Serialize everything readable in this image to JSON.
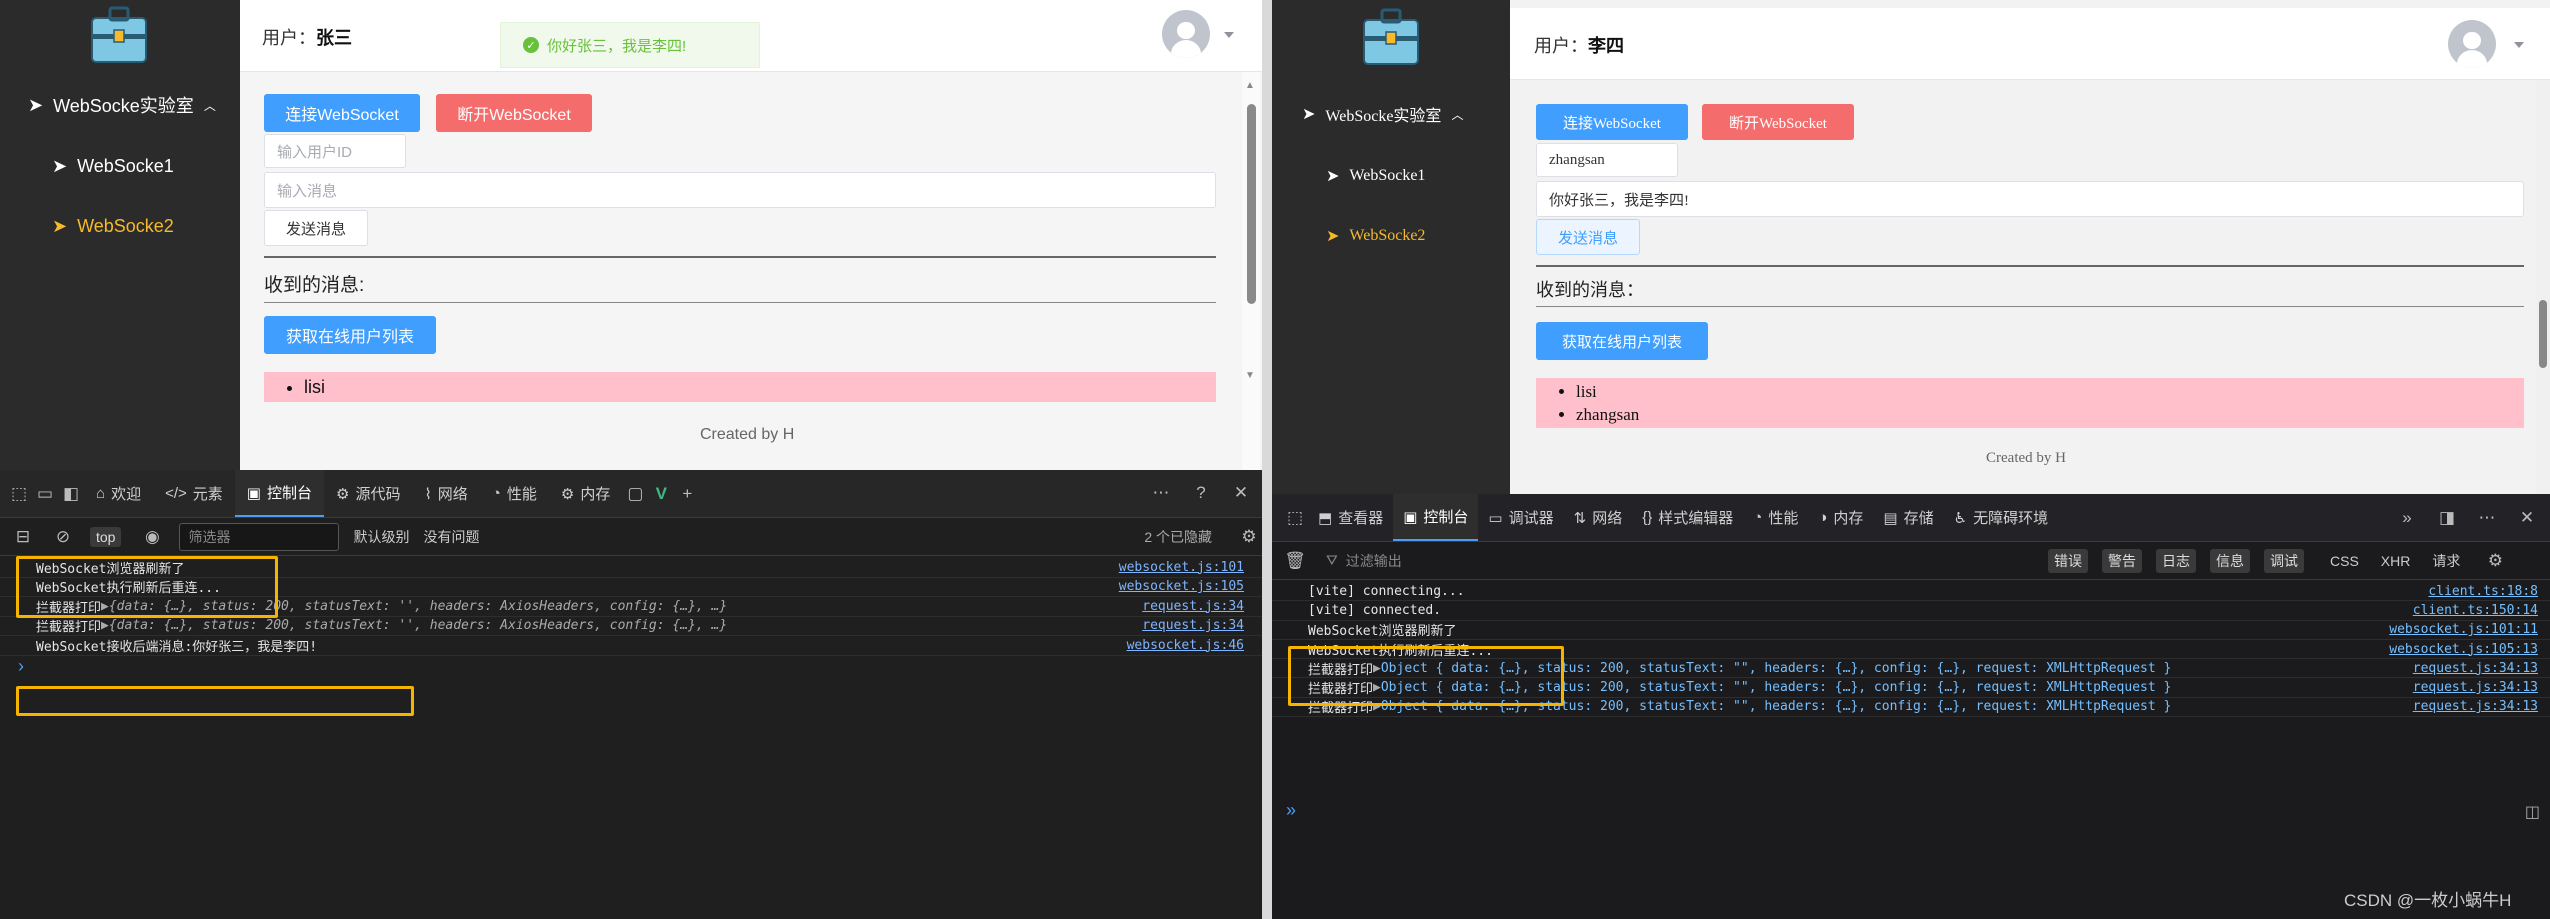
{
  "left": {
    "sidebar": {
      "menu_title": "WebSocke实验室",
      "items": [
        {
          "label": "WebSocke1",
          "active": false
        },
        {
          "label": "WebSocke2",
          "active": true
        }
      ]
    },
    "header": {
      "user_label": "用户：",
      "user_name": "张三"
    },
    "toast": "你好张三，我是李四!",
    "buttons": {
      "connect": "连接WebSocket",
      "disconnect": "断开WebSocket",
      "send": "发送消息",
      "get_users": "获取在线用户列表"
    },
    "inputs": {
      "user_id_placeholder": "输入用户ID",
      "message_placeholder": "输入消息"
    },
    "received_label": "收到的消息:",
    "online_users": [
      "lisi"
    ],
    "footer": "Created by H",
    "devtools": {
      "tabs": [
        "欢迎",
        "元素",
        "控制台",
        "源代码",
        "网络",
        "性能",
        "内存"
      ],
      "active_tab": "控制台",
      "context": "top",
      "filter_placeholder": "筛选器",
      "level": "默认级别",
      "issues": "没有问题",
      "hidden": "2 个已隐藏",
      "logs": [
        {
          "text": "WebSocket浏览器刷新了",
          "src": "websocket.js:101"
        },
        {
          "text": "WebSocket执行刷新后重连...",
          "src": "websocket.js:105"
        },
        {
          "text": "拦截器打印",
          "obj": "{data: {…}, status: 200, statusText: '', headers: AxiosHeaders, config: {…}, …}",
          "src": "request.js:34"
        },
        {
          "text": "拦截器打印",
          "obj": "{data: {…}, status: 200, statusText: '', headers: AxiosHeaders, config: {…}, …}",
          "src": "request.js:34"
        },
        {
          "text": "WebSocket接收后端消息:你好张三，我是李四!",
          "src": "websocket.js:46"
        }
      ]
    }
  },
  "right": {
    "sidebar": {
      "menu_title": "WebSocke实验室",
      "items": [
        {
          "label": "WebSocke1",
          "active": false
        },
        {
          "label": "WebSocke2",
          "active": true
        }
      ]
    },
    "header": {
      "user_label": "用户：",
      "user_name": "李四"
    },
    "buttons": {
      "connect": "连接WebSocket",
      "disconnect": "断开WebSocket",
      "send": "发送消息",
      "get_users": "获取在线用户列表"
    },
    "inputs": {
      "user_id_value": "zhangsan",
      "message_value": "你好张三，我是李四!"
    },
    "received_label": "收到的消息：",
    "online_users": [
      "lisi",
      "zhangsan"
    ],
    "footer": "Created by H",
    "devtools": {
      "tabs": [
        "查看器",
        "控制台",
        "调试器",
        "网络",
        "样式编辑器",
        "性能",
        "内存",
        "存储",
        "无障碍环境"
      ],
      "active_tab": "控制台",
      "filter_placeholder": "过滤输出",
      "filter_pills": [
        "错误",
        "警告",
        "日志",
        "信息",
        "调试"
      ],
      "filter_extra": [
        "CSS",
        "XHR",
        "请求"
      ],
      "logs": [
        {
          "text": "[vite] connecting...",
          "src": "client.ts:18:8"
        },
        {
          "text": "[vite] connected.",
          "src": "client.ts:150:14"
        },
        {
          "text": "WebSocket浏览器刷新了",
          "src": "websocket.js:101:11"
        },
        {
          "text": "WebSocket执行刷新后重连...",
          "src": "websocket.js:105:13"
        },
        {
          "text": "拦截器打印",
          "obj": "Object { data: {…}, status: 200, statusText: \"\", headers: {…}, config: {…}, request: XMLHttpRequest }",
          "src": "request.js:34:13"
        },
        {
          "text": "拦截器打印",
          "obj": "Object { data: {…}, status: 200, statusText: \"\", headers: {…}, config: {…}, request: XMLHttpRequest }",
          "src": "request.js:34:13"
        },
        {
          "text": "拦截器打印",
          "obj": "Object { data: {…}, status: 200, statusText: \"\", headers: {…}, config: {…}, request: XMLHttpRequest }",
          "src": "request.js:34:13"
        }
      ]
    }
  },
  "watermark": "CSDN @一枚小蜗牛H",
  "colors": {
    "primary": "#409eff",
    "danger": "#f56c6c",
    "success": "#67c23a",
    "active_menu": "#f7ba2a",
    "highlight": "#f5b400",
    "list_bg": "#ffc0cb"
  }
}
